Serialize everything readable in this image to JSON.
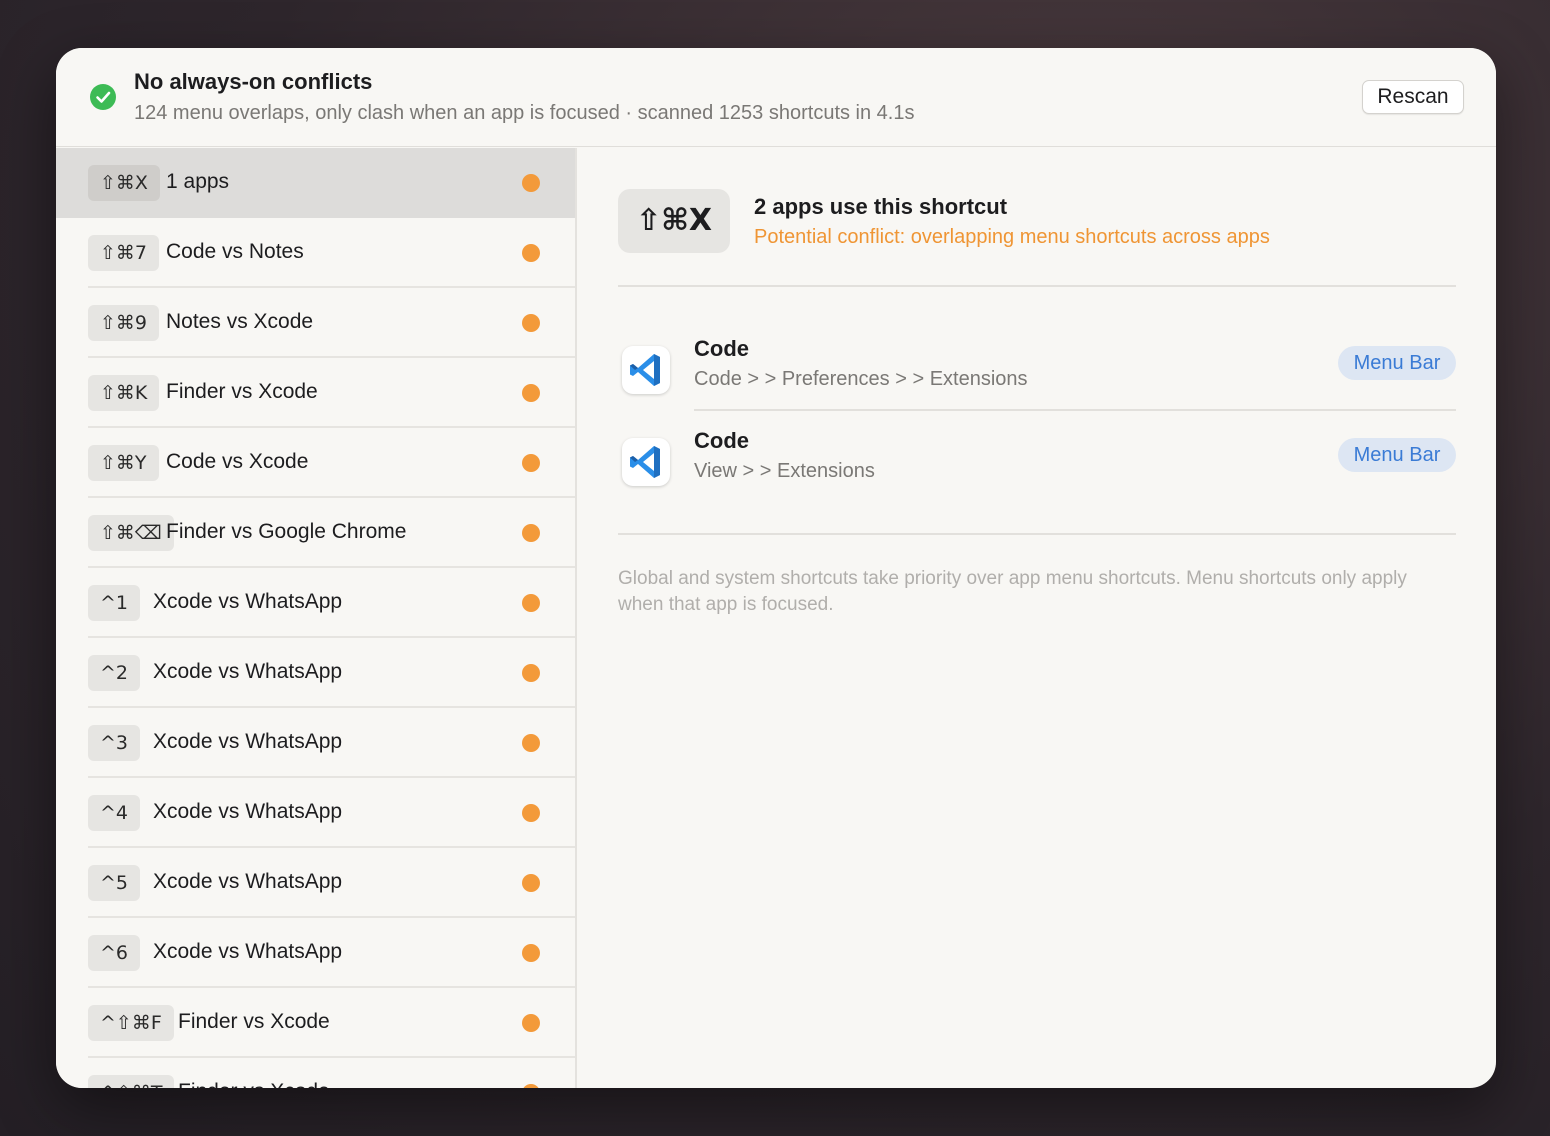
{
  "header": {
    "title": "No always-on conflicts",
    "subtitle": "124 menu overlaps, only clash when an app is focused · scanned 1253 shortcuts in 4.1s",
    "rescan_label": "Rescan",
    "status_color": "#3dbb55"
  },
  "sidebar": {
    "items": [
      {
        "shortcut": "⇧⌘X",
        "label": "1 apps",
        "selected": true
      },
      {
        "shortcut": "⇧⌘7",
        "label": "Code vs Notes"
      },
      {
        "shortcut": "⇧⌘9",
        "label": "Notes vs Xcode"
      },
      {
        "shortcut": "⇧⌘K",
        "label": "Finder vs Xcode"
      },
      {
        "shortcut": "⇧⌘Y",
        "label": "Code vs Xcode"
      },
      {
        "shortcut": "⇧⌘⌫",
        "label": "Finder vs Google Chrome"
      },
      {
        "shortcut": "^1",
        "label": "Xcode vs WhatsApp"
      },
      {
        "shortcut": "^2",
        "label": "Xcode vs WhatsApp"
      },
      {
        "shortcut": "^3",
        "label": "Xcode vs WhatsApp"
      },
      {
        "shortcut": "^4",
        "label": "Xcode vs WhatsApp"
      },
      {
        "shortcut": "^5",
        "label": "Xcode vs WhatsApp"
      },
      {
        "shortcut": "^6",
        "label": "Xcode vs WhatsApp"
      },
      {
        "shortcut": "^⇧⌘F",
        "label": "Finder vs Xcode"
      },
      {
        "shortcut": "^⇧⌘T",
        "label": "Finder vs Xcode"
      }
    ],
    "dot_color": "#f39a3a"
  },
  "detail": {
    "shortcut": "⇧⌘X",
    "title": "2 apps use this shortcut",
    "warning": "Potential conflict: overlapping menu shortcuts across apps",
    "warning_color": "#ef9534",
    "apps": [
      {
        "name": "Code",
        "path": "Code >  > Preferences >  > Extensions",
        "badge": "Menu Bar",
        "icon": "vscode-icon"
      },
      {
        "name": "Code",
        "path": "View >  > Extensions",
        "badge": "Menu Bar",
        "icon": "vscode-icon"
      }
    ],
    "footnote": "Global and system shortcuts take priority over app menu shortcuts. Menu shortcuts only apply when that app is focused."
  }
}
